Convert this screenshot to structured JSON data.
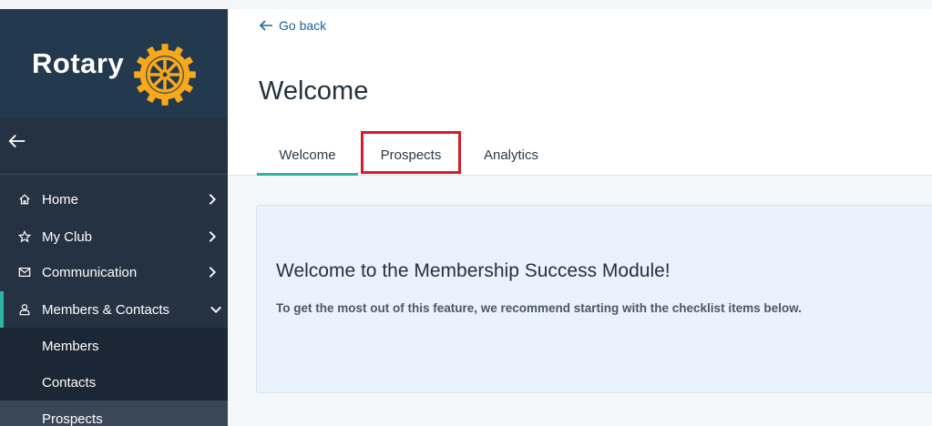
{
  "brand": {
    "name": "Rotary",
    "accent": "#f7a81b"
  },
  "sidebar": {
    "nav": [
      {
        "label": "Home",
        "icon": "home-icon"
      },
      {
        "label": "My Club",
        "icon": "star-icon"
      },
      {
        "label": "Communication",
        "icon": "mail-icon"
      },
      {
        "label": "Members & Contacts",
        "icon": "person-icon",
        "expanded": true
      }
    ],
    "sub": [
      {
        "label": "Members"
      },
      {
        "label": "Contacts"
      },
      {
        "label": "Prospects",
        "selected": true
      }
    ]
  },
  "header": {
    "go_back": "Go back",
    "title": "Welcome",
    "tabs": [
      {
        "label": "Welcome",
        "active": true
      },
      {
        "label": "Prospects",
        "highlighted": true
      },
      {
        "label": "Analytics"
      }
    ]
  },
  "card": {
    "title": "Welcome to the Membership Success Module!",
    "text": "To get the most out of this feature, we recommend starting with the checklist items below."
  },
  "colors": {
    "sidebar": "#253242",
    "teal": "#2fb3a5",
    "highlight": "#d81a2a",
    "link": "#17669b"
  }
}
